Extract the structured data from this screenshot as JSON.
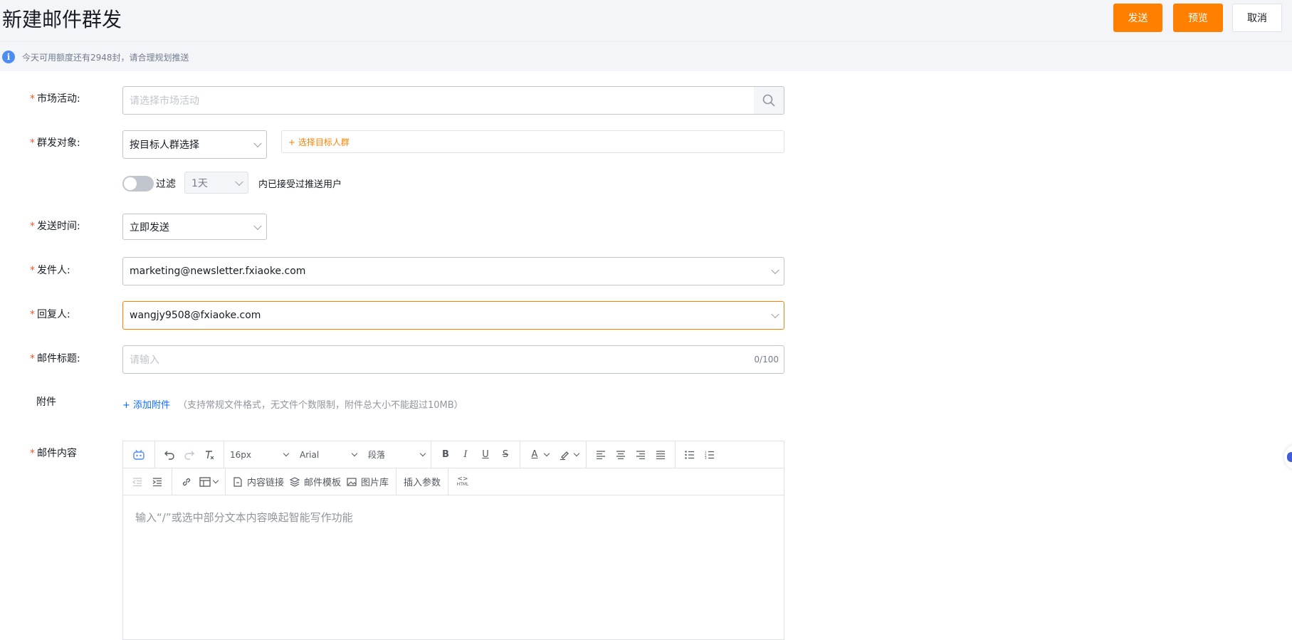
{
  "header": {
    "title": "新建邮件群发",
    "send_label": "发送",
    "preview_label": "预览",
    "cancel_label": "取消"
  },
  "notice": {
    "icon": "info-icon",
    "text": "今天可用额度还有2948封，请合理规划推送"
  },
  "form": {
    "campaign": {
      "label": "市场活动:",
      "placeholder": "请选择市场活动"
    },
    "audience": {
      "label": "群发对象:",
      "mode_value": "按目标人群选择",
      "add_link": "+ 选择目标人群",
      "filter_label": "过滤",
      "filter_enabled": false,
      "period_value": "1天",
      "filter_suffix": "内已接受过推送用户"
    },
    "send_time": {
      "label": "发送时间:",
      "value": "立即发送"
    },
    "sender": {
      "label": "发件人:",
      "value": "marketing@newsletter.fxiaoke.com"
    },
    "reply_to": {
      "label": "回复人:",
      "value": "wangjy9508@fxiaoke.com"
    },
    "subject": {
      "label": "邮件标题:",
      "placeholder": "请输入",
      "counter": "0/100"
    },
    "attachment": {
      "label": "附件",
      "add_link": "+ 添加附件",
      "hint": "（支持常规文件格式，无文件个数限制，附件总大小不能超过10MB）"
    },
    "content": {
      "label": "邮件内容",
      "toolbar": {
        "font_size": "16px",
        "font_family": "Arial",
        "paragraph": "段落",
        "bold": "B",
        "italic": "I",
        "underline": "U",
        "strike": "S",
        "font_color": "A",
        "content_link": "内容链接",
        "mail_template": "邮件模板",
        "image_library": "图片库",
        "insert_params": "插入参数",
        "html": "HTML"
      },
      "placeholder": "输入“/”或选中部分文本内容唤起智能写作功能"
    }
  },
  "colors": {
    "accent": "#ff8000",
    "required": "#ff522a",
    "info": "#4d8cf5",
    "link_blue": "#0c6cff"
  }
}
